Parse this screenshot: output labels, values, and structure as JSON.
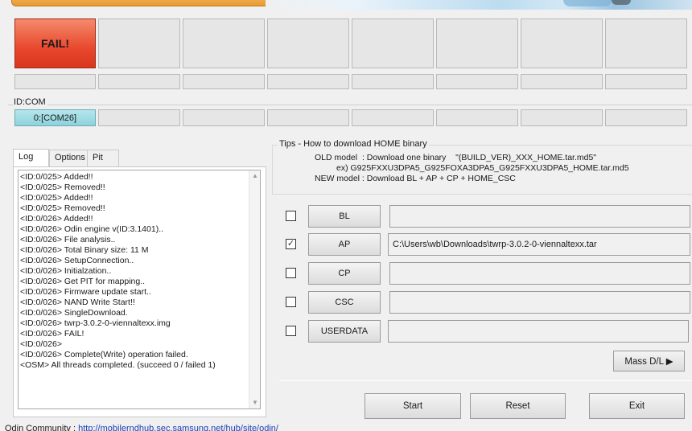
{
  "ports": {
    "status_label": "FAIL!",
    "com_label": "ID:COM",
    "com_value": "0:[COM26]",
    "colors": {
      "fail": "#e8482d",
      "com_active": "#8dd2dc"
    }
  },
  "tabs": [
    {
      "label": "Log"
    },
    {
      "label": "Options"
    },
    {
      "label": "Pit"
    }
  ],
  "log": {
    "lines": [
      "<ID:0/025> Added!!",
      "<ID:0/025> Removed!!",
      "<ID:0/025> Added!!",
      "<ID:0/025> Removed!!",
      "<ID:0/026> Added!!",
      "<ID:0/026> Odin engine v(ID:3.1401)..",
      "<ID:0/026> File analysis..",
      "<ID:0/026> Total Binary size: 11 M",
      "<ID:0/026> SetupConnection..",
      "<ID:0/026> Initialzation..",
      "<ID:0/026> Get PIT for mapping..",
      "<ID:0/026> Firmware update start..",
      "<ID:0/026> NAND Write Start!!",
      "<ID:0/026> SingleDownload.",
      "<ID:0/026> twrp-3.0.2-0-viennaltexx.img",
      "<ID:0/026> FAIL!",
      "<ID:0/026>",
      "<ID:0/026> Complete(Write) operation failed.",
      "<OSM> All threads completed. (succeed 0 / failed 1)"
    ]
  },
  "tips": {
    "title": "Tips - How to download HOME binary",
    "old_model": "OLD model  : Download one binary    \"(BUILD_VER)_XXX_HOME.tar.md5\"",
    "old_example": "ex) G925FXXU3DPA5_G925FOXA3DPA5_G925FXXU3DPA5_HOME.tar.md5",
    "new_model": "NEW model : Download BL + AP + CP + HOME_CSC"
  },
  "files": [
    {
      "label": "BL",
      "checked": false,
      "path": ""
    },
    {
      "label": "AP",
      "checked": true,
      "path": "C:\\Users\\wb\\Downloads\\twrp-3.0.2-0-viennaltexx.tar"
    },
    {
      "label": "CP",
      "checked": false,
      "path": ""
    },
    {
      "label": "CSC",
      "checked": false,
      "path": ""
    },
    {
      "label": "USERDATA",
      "checked": false,
      "path": ""
    }
  ],
  "buttons": {
    "mass_dl": "Mass D/L ▶",
    "start": "Start",
    "reset": "Reset",
    "exit": "Exit"
  },
  "footer": {
    "label": "Odin Community : ",
    "link": "http://mobilerndhub.sec.samsung.net/hub/site/odin/"
  }
}
